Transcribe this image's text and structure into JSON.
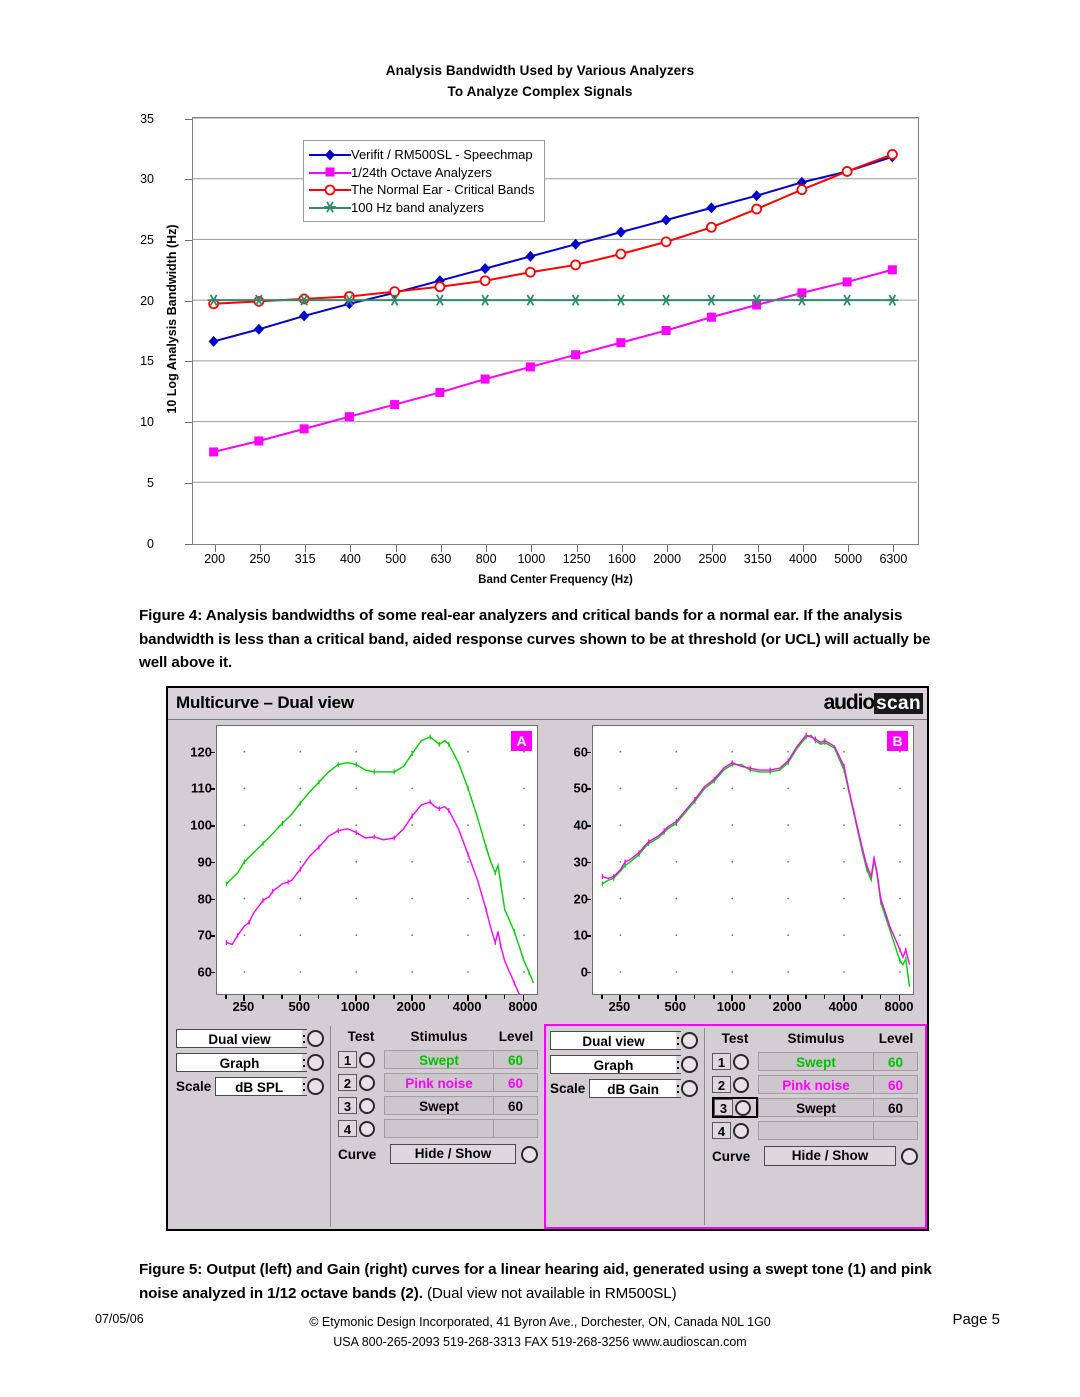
{
  "fig4": {
    "title_line1": "Analysis Bandwidth Used by Various Analyzers",
    "title_line2": "To Analyze Complex Signals",
    "caption": "Figure 4: Analysis bandwidths of some real-ear analyzers and critical bands for a normal ear. If the analysis bandwidth is less than a critical band, aided response curves shown to be at threshold (or UCL) will actually be well above it."
  },
  "chart_data": {
    "type": "line",
    "title": "Analysis Bandwidth Used by Various Analyzers To Analyze Complex Signals",
    "xlabel": "Band Center Frequency (Hz)",
    "ylabel": "10 Log Analysis Bandwidth (Hz)",
    "categories": [
      "200",
      "250",
      "315",
      "400",
      "500",
      "630",
      "800",
      "1000",
      "1250",
      "1600",
      "2000",
      "2500",
      "3150",
      "4000",
      "5000",
      "6300"
    ],
    "ylim": [
      0,
      35
    ],
    "yticks": [
      0,
      5,
      10,
      15,
      20,
      25,
      30,
      35
    ],
    "grid": true,
    "legend_position": "top-center-inside",
    "series": [
      {
        "name": "Verifit / RM500SL - Speechmap",
        "color": "#0000cc",
        "marker": "filled-diamond",
        "values": [
          16.6,
          17.6,
          18.7,
          19.7,
          20.6,
          21.6,
          22.6,
          23.6,
          24.6,
          25.6,
          26.6,
          27.6,
          28.6,
          29.7,
          30.6,
          31.8
        ]
      },
      {
        "name": "1/24th Octave Analyzers",
        "color": "#ff00ff",
        "marker": "filled-square",
        "values": [
          7.5,
          8.4,
          9.4,
          10.4,
          11.4,
          12.4,
          13.5,
          14.5,
          15.5,
          16.5,
          17.5,
          18.6,
          19.6,
          20.6,
          21.5,
          22.5
        ]
      },
      {
        "name": "The Normal Ear - Critical Bands",
        "color": "#ff0000",
        "marker": "open-circle",
        "values": [
          19.7,
          19.9,
          20.1,
          20.3,
          20.7,
          21.1,
          21.6,
          22.3,
          22.9,
          23.8,
          24.8,
          26.0,
          27.5,
          29.1,
          30.6,
          32.0
        ]
      },
      {
        "name": "100 Hz band analyzers",
        "color": "#2e8b6b",
        "marker": "asterisk",
        "values": [
          20,
          20,
          20,
          20,
          20,
          20,
          20,
          20,
          20,
          20,
          20,
          20,
          20,
          20,
          20,
          20
        ]
      }
    ]
  },
  "app": {
    "title": "Multicurve – Dual view",
    "brand_part1": "audio",
    "brand_part2": "scan",
    "pane_a": {
      "badge": "A",
      "yticks": [
        "120",
        "110",
        "100",
        "90",
        "80",
        "70",
        "60"
      ],
      "xticks": [
        "250",
        "500",
        "1000",
        "2000",
        "4000",
        "8000"
      ]
    },
    "pane_b": {
      "badge": "B",
      "yticks": [
        "60",
        "50",
        "40",
        "30",
        "20",
        "10",
        "0"
      ],
      "xticks": [
        "250",
        "500",
        "1000",
        "2000",
        "4000",
        "8000"
      ]
    },
    "controls_a": {
      "view_select": "Dual view",
      "display_select": "Graph",
      "scale_label": "Scale",
      "scale_select": "dB SPL",
      "header_test": "Test",
      "header_stimulus": "Stimulus",
      "header_level": "Level",
      "rows": [
        {
          "num": "1",
          "stimulus": "Swept",
          "level": "60",
          "color": "green",
          "selected": false
        },
        {
          "num": "2",
          "stimulus": "Pink noise",
          "level": "60",
          "color": "magenta",
          "selected": false
        },
        {
          "num": "3",
          "stimulus": "Swept",
          "level": "60",
          "color": "black",
          "selected": false
        },
        {
          "num": "4",
          "stimulus": "",
          "level": "",
          "color": "black",
          "selected": false
        }
      ],
      "curve_label": "Curve",
      "hide_show": "Hide / Show"
    },
    "controls_b": {
      "view_select": "Dual view",
      "display_select": "Graph",
      "scale_label": "Scale",
      "scale_select": "dB Gain",
      "header_test": "Test",
      "header_stimulus": "Stimulus",
      "header_level": "Level",
      "rows": [
        {
          "num": "1",
          "stimulus": "Swept",
          "level": "60",
          "color": "green",
          "selected": false
        },
        {
          "num": "2",
          "stimulus": "Pink noise",
          "level": "60",
          "color": "magenta",
          "selected": false
        },
        {
          "num": "3",
          "stimulus": "Swept",
          "level": "60",
          "color": "black",
          "selected": true
        },
        {
          "num": "4",
          "stimulus": "",
          "level": "",
          "color": "black",
          "selected": false
        }
      ],
      "curve_label": "Curve",
      "hide_show": "Hide / Show"
    }
  },
  "fig5": {
    "caption_bold": "Figure 5:  Output (left) and Gain (right) curves for a linear hearing aid, generated using a swept tone (1) and pink noise analyzed in 1/12 octave bands (2).",
    "caption_normal": " (Dual view not available in RM500SL)"
  },
  "footer": {
    "date": "07/05/06",
    "line1": "© Etymonic Design Incorporated, 41 Byron Ave., Dorchester, ON, Canada  N0L 1G0",
    "line2": "USA 800-265-2093  519-268-3313  FAX 519-268-3256  www.audioscan.com",
    "page": "Page 5"
  }
}
